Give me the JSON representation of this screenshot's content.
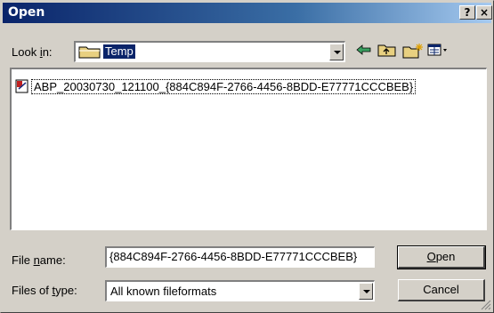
{
  "window": {
    "title": "Open",
    "help_label": "?",
    "close_label": "×"
  },
  "look_in": {
    "label_pre": "Look ",
    "label_key": "i",
    "label_post": "n:",
    "value": "Temp"
  },
  "toolbar": {
    "back_icon": "back-arrow-icon",
    "up_icon": "folder-up-icon",
    "new_folder_icon": "new-folder-icon",
    "view_icon": "view-menu-icon"
  },
  "files": [
    {
      "name": "ABP_20030730_121100_{884C894F-2766-4456-8BDD-E77771CCCBEB}",
      "icon": "document-icon"
    }
  ],
  "file_name": {
    "label_pre": "File ",
    "label_key": "n",
    "label_post": "ame:",
    "value": "{884C894F-2766-4456-8BDD-E77771CCCBEB}"
  },
  "file_type": {
    "label_pre": "Files of ",
    "label_key": "t",
    "label_post": "ype:",
    "value": "All known fileformats"
  },
  "buttons": {
    "open_key": "O",
    "open_rest": "pen",
    "cancel": "Cancel"
  },
  "colors": {
    "title_start": "#0a246a",
    "title_end": "#a6caf0",
    "face": "#d4d0c8",
    "selection": "#0a246a"
  }
}
